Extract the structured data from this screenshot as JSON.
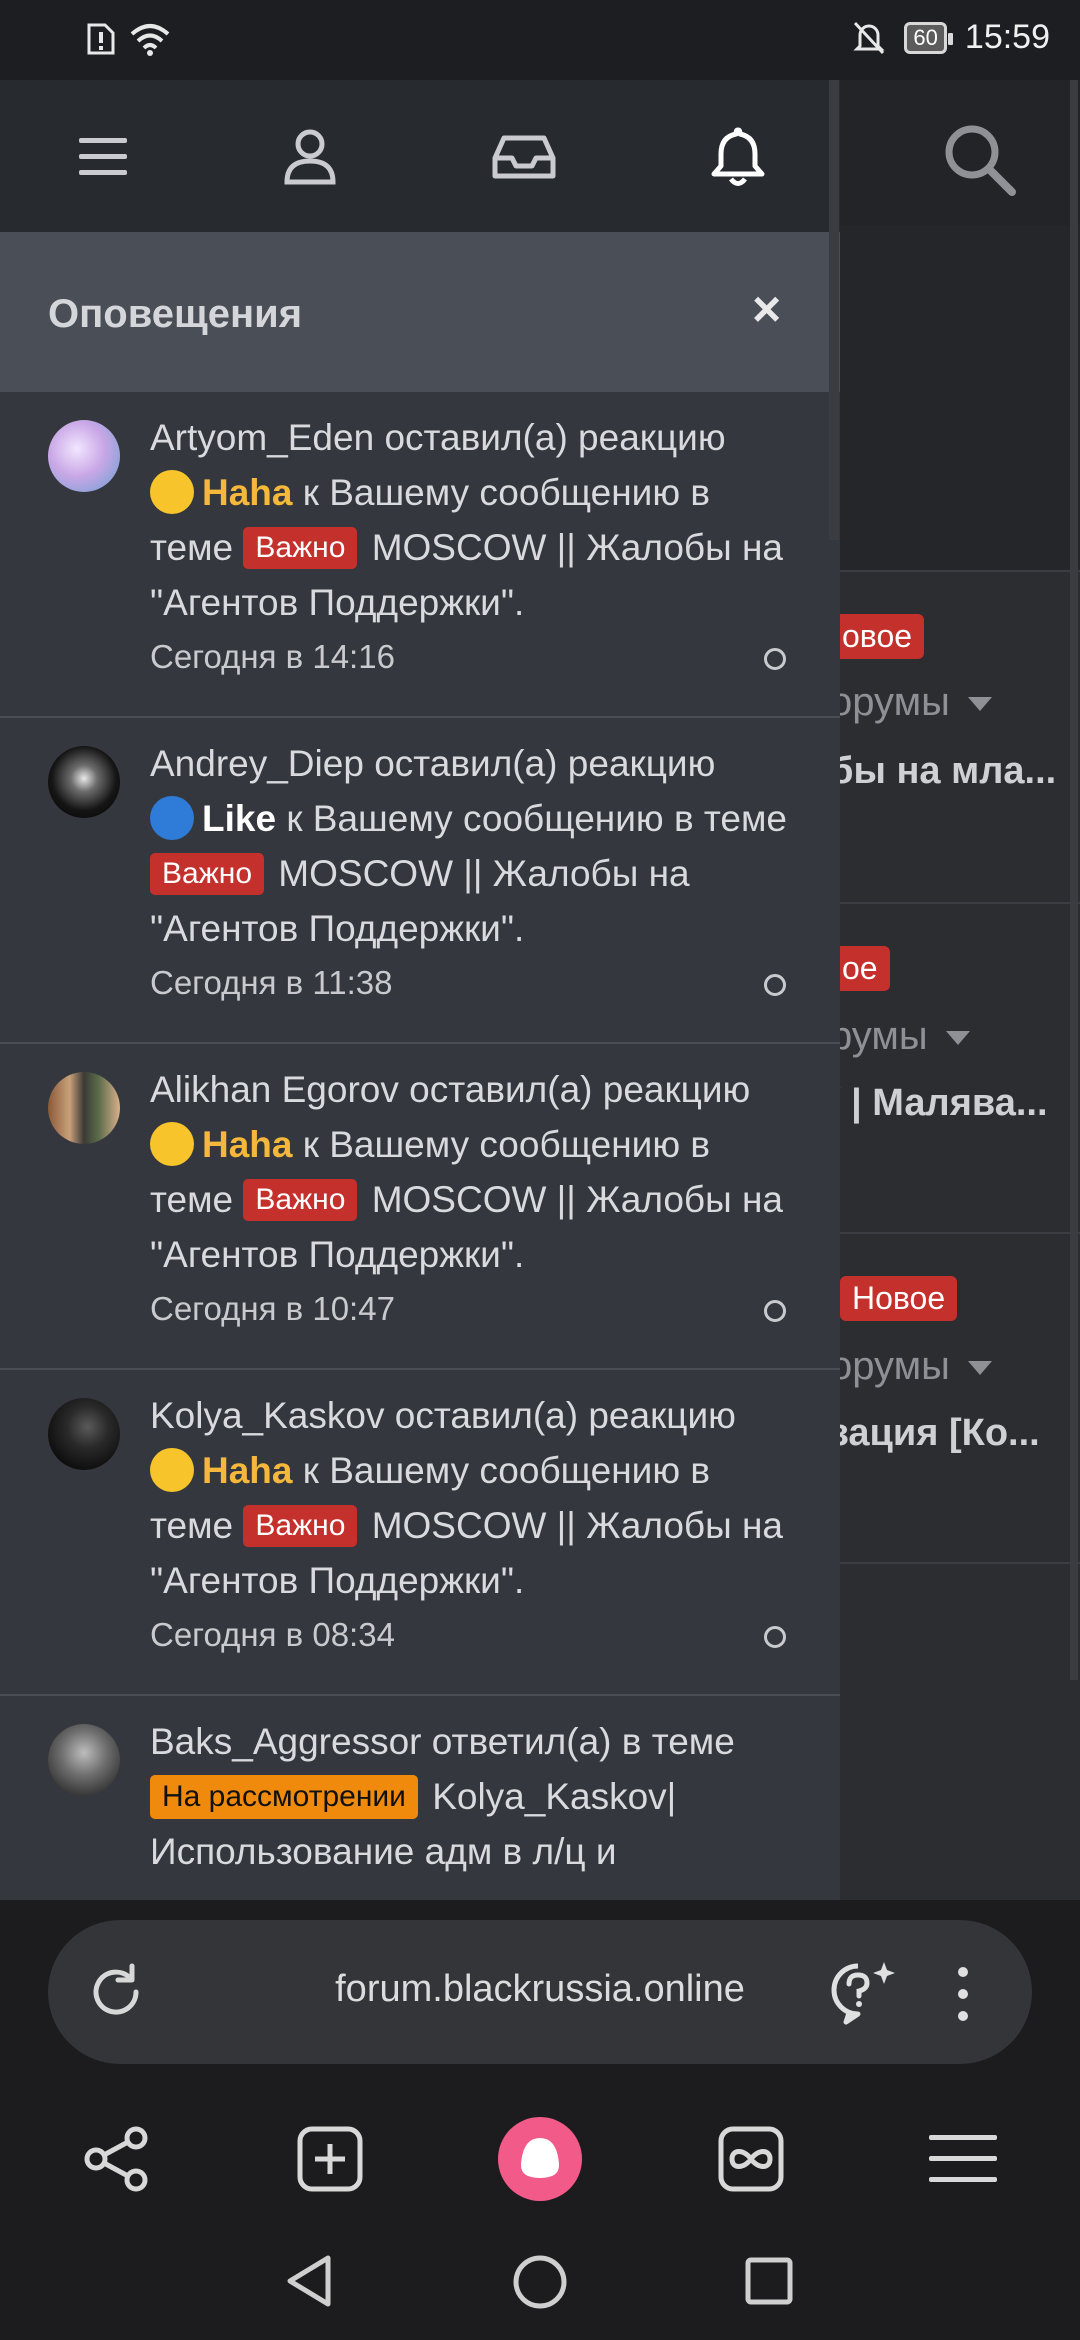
{
  "status": {
    "time": "15:59",
    "battery": "60"
  },
  "drawer": {
    "title": "Оповещения",
    "close": "×"
  },
  "notifications": [
    {
      "user": "Artyom_Eden",
      "action": "оставил(а) реакцию",
      "reaction": "Haha",
      "reaction_type": "haha",
      "pre_tag": "к Вашему сообщению в теме",
      "tag": "Важно",
      "thread": "MOSCOW || Жалобы на \"Агентов Поддержки\".",
      "time": "Сегодня в 14:16"
    },
    {
      "user": "Andrey_Diep",
      "action": "оставил(а) реакцию",
      "reaction": "Like",
      "reaction_type": "like",
      "pre_tag": "к Вашему сообщению в теме",
      "tag": "Важно",
      "thread": "MOSCOW || Жалобы на \"Агентов Поддержки\".",
      "time": "Сегодня в 11:38"
    },
    {
      "user": "Alikhan Egorov",
      "action": "оставил(а) реакцию",
      "reaction": "Haha",
      "reaction_type": "haha",
      "pre_tag": "к Вашему сообщению в теме",
      "tag": "Важно",
      "thread": "MOSCOW || Жалобы на \"Агентов Поддержки\".",
      "time": "Сегодня в 10:47"
    },
    {
      "user": "Kolya_Kaskov",
      "action": "оставил(а) реакцию",
      "reaction": "Haha",
      "reaction_type": "haha",
      "pre_tag": "к Вашему сообщению в теме",
      "tag": "Важно",
      "thread": "MOSCOW || Жалобы на \"Агентов Поддержки\".",
      "time": "Сегодня в 08:34"
    },
    {
      "user": "Baks_Aggressor",
      "action": "ответил(а) в теме",
      "tag": "На рассмотрении",
      "thread": "Kolya_Kaskov| Использование адм в л/ц и"
    }
  ],
  "background": {
    "badge1": "овое",
    "forums1": "орумы",
    "title1": "бы на мла...",
    "badge2": "ое",
    "forums2": "румы",
    "title2": "/ | Малява...",
    "badge3": "Новое",
    "forums3": "орумы",
    "title3": "зация [Ко..."
  },
  "browser": {
    "url": "forum.blackrussia.online"
  },
  "colors": {
    "accent_red": "#c4302b",
    "accent_orange": "#f08a0c",
    "haha_yellow": "#f5b83a",
    "alice_pink": "#f25a8a"
  }
}
